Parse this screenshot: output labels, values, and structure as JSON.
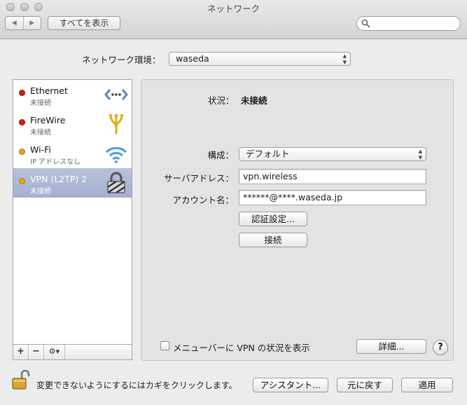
{
  "window": {
    "title": "ネットワーク"
  },
  "toolbar": {
    "back_label": "◀",
    "forward_label": "▶",
    "show_all_label": "すべてを表示",
    "search_placeholder": ""
  },
  "location": {
    "label": "ネットワーク環境：",
    "value": "waseda"
  },
  "services": [
    {
      "name": "Ethernet",
      "status": "未接続",
      "status_color": "#d21d12",
      "icon": "ethernet-icon"
    },
    {
      "name": "FireWire",
      "status": "未接続",
      "status_color": "#d21d12",
      "icon": "firewire-icon"
    },
    {
      "name": "Wi-Fi",
      "status": "IP アドレスなし",
      "status_color": "#e8a317",
      "icon": "wifi-icon"
    },
    {
      "name": "VPN (L2TP) 2",
      "status": "未接続",
      "status_color": "#e8a317",
      "icon": "vpn-lock-icon",
      "selected": true
    }
  ],
  "sidebar_tools": {
    "add": "+",
    "remove": "−",
    "gear": "⚙▾"
  },
  "detail": {
    "status_label": "状況：",
    "status_value": "未接続",
    "config_label": "構成：",
    "config_value": "デフォルト",
    "server_label": "サーバアドレス：",
    "server_value": "vpn.wireless",
    "account_label": "アカウント名：",
    "account_value": "******@****.waseda.jp",
    "auth_button": "認証設定...",
    "connect_button": "接続",
    "show_status_label": "メニューバーに VPN の状況を表示",
    "show_status_checked": false,
    "advanced_button": "詳細...",
    "help_label": "?"
  },
  "footer": {
    "lock_text": "変更できないようにするにはカギをクリックします。",
    "assistant_button": "アシスタント...",
    "revert_button": "元に戻す",
    "apply_button": "適用"
  },
  "colors": {
    "selection": "#a9b4d1",
    "red_status": "#d21d12",
    "yellow_status": "#e8a317"
  }
}
